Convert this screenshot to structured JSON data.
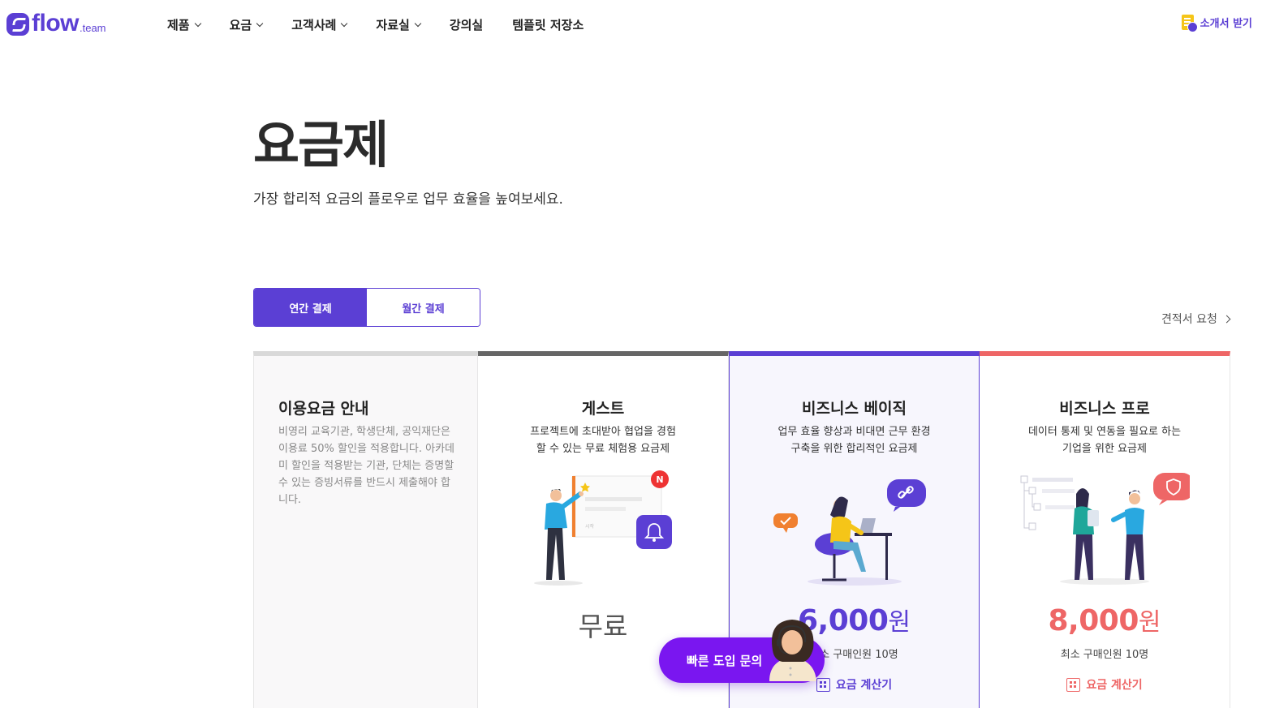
{
  "header": {
    "logo_text": "flow",
    "logo_sub": ".team",
    "nav": [
      {
        "label": "제품",
        "dropdown": true
      },
      {
        "label": "요금",
        "dropdown": true
      },
      {
        "label": "고객사례",
        "dropdown": true
      },
      {
        "label": "자료실",
        "dropdown": true
      },
      {
        "label": "강의실",
        "dropdown": false
      },
      {
        "label": "템플릿 저장소",
        "dropdown": false
      }
    ],
    "brochure_label": "소개서 받기"
  },
  "hero": {
    "title": "요금제",
    "subtitle": "가장 합리적 요금의 플로우로 업무 효율을 높여보세요."
  },
  "billing_toggle": {
    "annual": "연간 결제",
    "monthly": "월간 결제",
    "selected": "annual"
  },
  "quote_link": "견적서 요청",
  "plans": {
    "info": {
      "title": "이용요금 안내",
      "description": "비영리 교육기관, 학생단체, 공익재단은 이용료 50% 할인을 적용합니다. 아카데미 할인을 적용받는 기관, 단체는 증명할 수 있는 증빙서류를 반드시 제출해야 합니다."
    },
    "guest": {
      "name": "게스트",
      "desc_line1": "프로젝트에 초대받아 협업을 경험",
      "desc_line2": "할 수 있는 무료 체험용 요금제",
      "price": "무료",
      "badge": "N"
    },
    "basic": {
      "name": "비즈니스 베이직",
      "desc_line1": "업무 효율 향상과 비대면 근무 환경",
      "desc_line2": "구축을 위한 합리적인 요금제",
      "price": "6,000",
      "unit": "원",
      "min_users": "최소 구매인원 10명",
      "calc_label": "요금 계산기"
    },
    "pro": {
      "name": "비즈니스 프로",
      "desc_line1": "데이터 통제 및 연동을 필요로 하는",
      "desc_line2": "기업을 위한 요금제",
      "price": "8,000",
      "unit": "원",
      "min_users": "최소 구매인원 10명",
      "calc_label": "요금 계산기"
    }
  },
  "cta": {
    "label": "빠른 도입 문의"
  },
  "colors": {
    "brand": "#5b3fd4",
    "pro_accent": "#ee6666",
    "cta": "#7a16f0"
  }
}
